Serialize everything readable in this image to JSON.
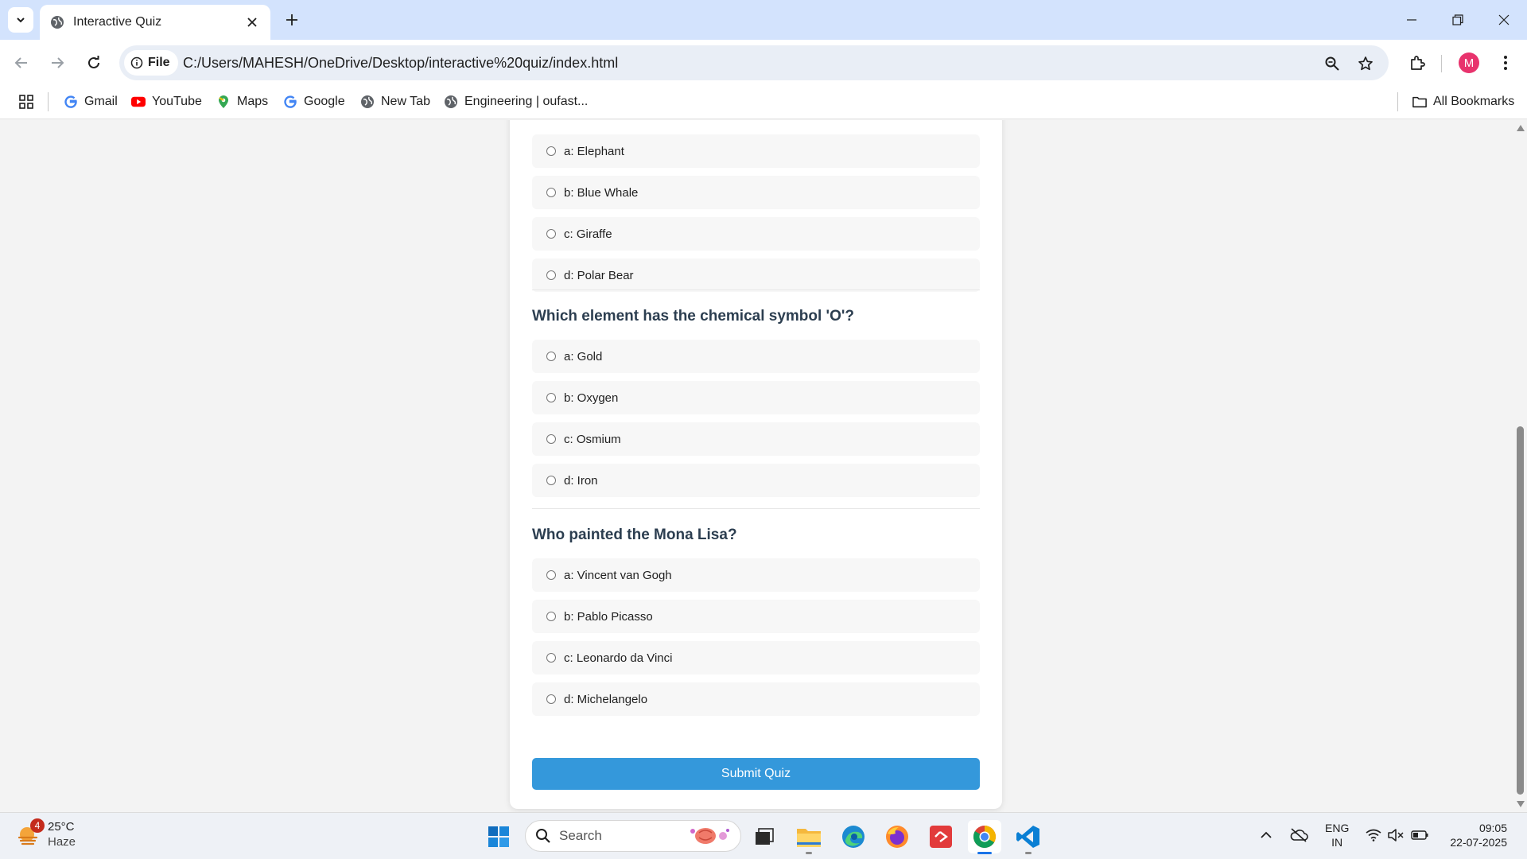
{
  "browser": {
    "tab_title": "Interactive Quiz",
    "site_chip_label": "File",
    "url": "C:/Users/MAHESH/OneDrive/Desktop/interactive%20quiz/index.html",
    "profile_initial": "M",
    "accent": "#d3e3fd"
  },
  "bookmarks": {
    "items": [
      {
        "label": "Gmail",
        "icon": "google-icon"
      },
      {
        "label": "YouTube",
        "icon": "youtube-icon"
      },
      {
        "label": "Maps",
        "icon": "maps-icon"
      },
      {
        "label": "Google",
        "icon": "google-icon"
      },
      {
        "label": "New Tab",
        "icon": "globe-icon"
      },
      {
        "label": "Engineering | oufast...",
        "icon": "globe-icon"
      }
    ],
    "all_bookmarks_label": "All Bookmarks"
  },
  "quiz": {
    "questions": [
      {
        "text": "",
        "options": [
          "a: Elephant",
          "b: Blue Whale",
          "c: Giraffe",
          "d: Polar Bear"
        ]
      },
      {
        "text": "Which element has the chemical symbol 'O'?",
        "options": [
          "a: Gold",
          "b: Oxygen",
          "c: Osmium",
          "d: Iron"
        ]
      },
      {
        "text": "Who painted the Mona Lisa?",
        "options": [
          "a: Vincent van Gogh",
          "b: Pablo Picasso",
          "c: Leonardo da Vinci",
          "d: Michelangelo"
        ]
      }
    ],
    "submit_label": "Submit Quiz",
    "button_color": "#3498db",
    "heading_color": "#2c3e50"
  },
  "taskbar": {
    "weather_temp": "25°C",
    "weather_condition": "Haze",
    "weather_badge": "4",
    "search_placeholder": "Search",
    "language_line1": "ENG",
    "language_line2": "IN",
    "time": "09:05",
    "date": "22-07-2025"
  }
}
